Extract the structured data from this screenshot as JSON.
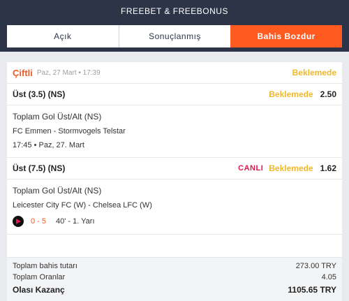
{
  "header": {
    "title": "FREEBET & FREEBONUS"
  },
  "tabs": [
    {
      "label": "Açık"
    },
    {
      "label": "Sonuçlanmış"
    },
    {
      "label": "Bahis Bozdur"
    }
  ],
  "bet": {
    "type": "Çiftli",
    "date": "Paz, 27 Mart • 17:39",
    "status": "Beklemede"
  },
  "selections": [
    {
      "name": "Üst (3.5) (NS)",
      "status": "Beklemede",
      "odds": "2.50",
      "market": "Toplam Gol Üst/Alt (NS)",
      "teams": "FC Emmen - Stormvogels Telstar",
      "time": "17:45 • Paz, 27. Mart"
    },
    {
      "name": "Üst (7.5) (NS)",
      "live_label": "CANLI",
      "status": "Beklemede",
      "odds": "1.62",
      "market": "Toplam Gol Üst/Alt (NS)",
      "teams": "Leicester City FC (W) - Chelsea LFC (W)",
      "score": "0 - 5",
      "minute": "40' - 1. Yarı",
      "play_icon": "play-icon"
    }
  ],
  "summary": {
    "stake_label": "Toplam bahis tutarı",
    "stake_value": "273.00 TRY",
    "odds_label": "Toplam Oranlar",
    "odds_value": "4.05",
    "win_label": "Olası Kazanç",
    "win_value": "1105.65 TRY"
  },
  "colors": {
    "header_bg": "#2d3447",
    "accent": "#ff5a1f",
    "pending": "#f0b92c",
    "live": "#e2174e"
  }
}
